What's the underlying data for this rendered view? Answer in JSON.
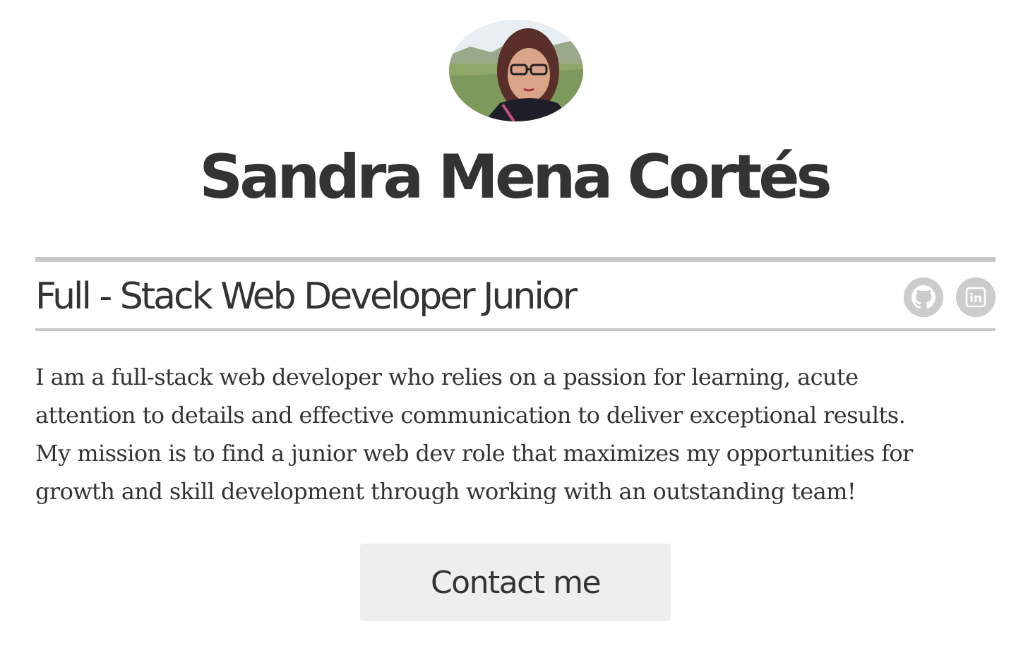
{
  "profile": {
    "name": "Sandra Mena Cortés",
    "role": "Full - Stack Web Developer Junior",
    "bio_lines": [
      "I am a full-stack web developer who relies on a passion for learning, acute",
      "attention to details and effective communication to deliver exceptional results.",
      "My mission is to find a junior web dev role that maximizes my opportunities for",
      "growth and skill development through working with an outstanding team!"
    ]
  },
  "social": {
    "github_icon": "github-icon",
    "linkedin_icon": "linkedin-icon",
    "linkedin_text": "in"
  },
  "cta": {
    "contact_label": "Contact me"
  },
  "colors": {
    "text": "#333333",
    "rule": "#c8c8c8",
    "icon_bg": "#cccccc",
    "button_bg": "#eeeeee"
  }
}
